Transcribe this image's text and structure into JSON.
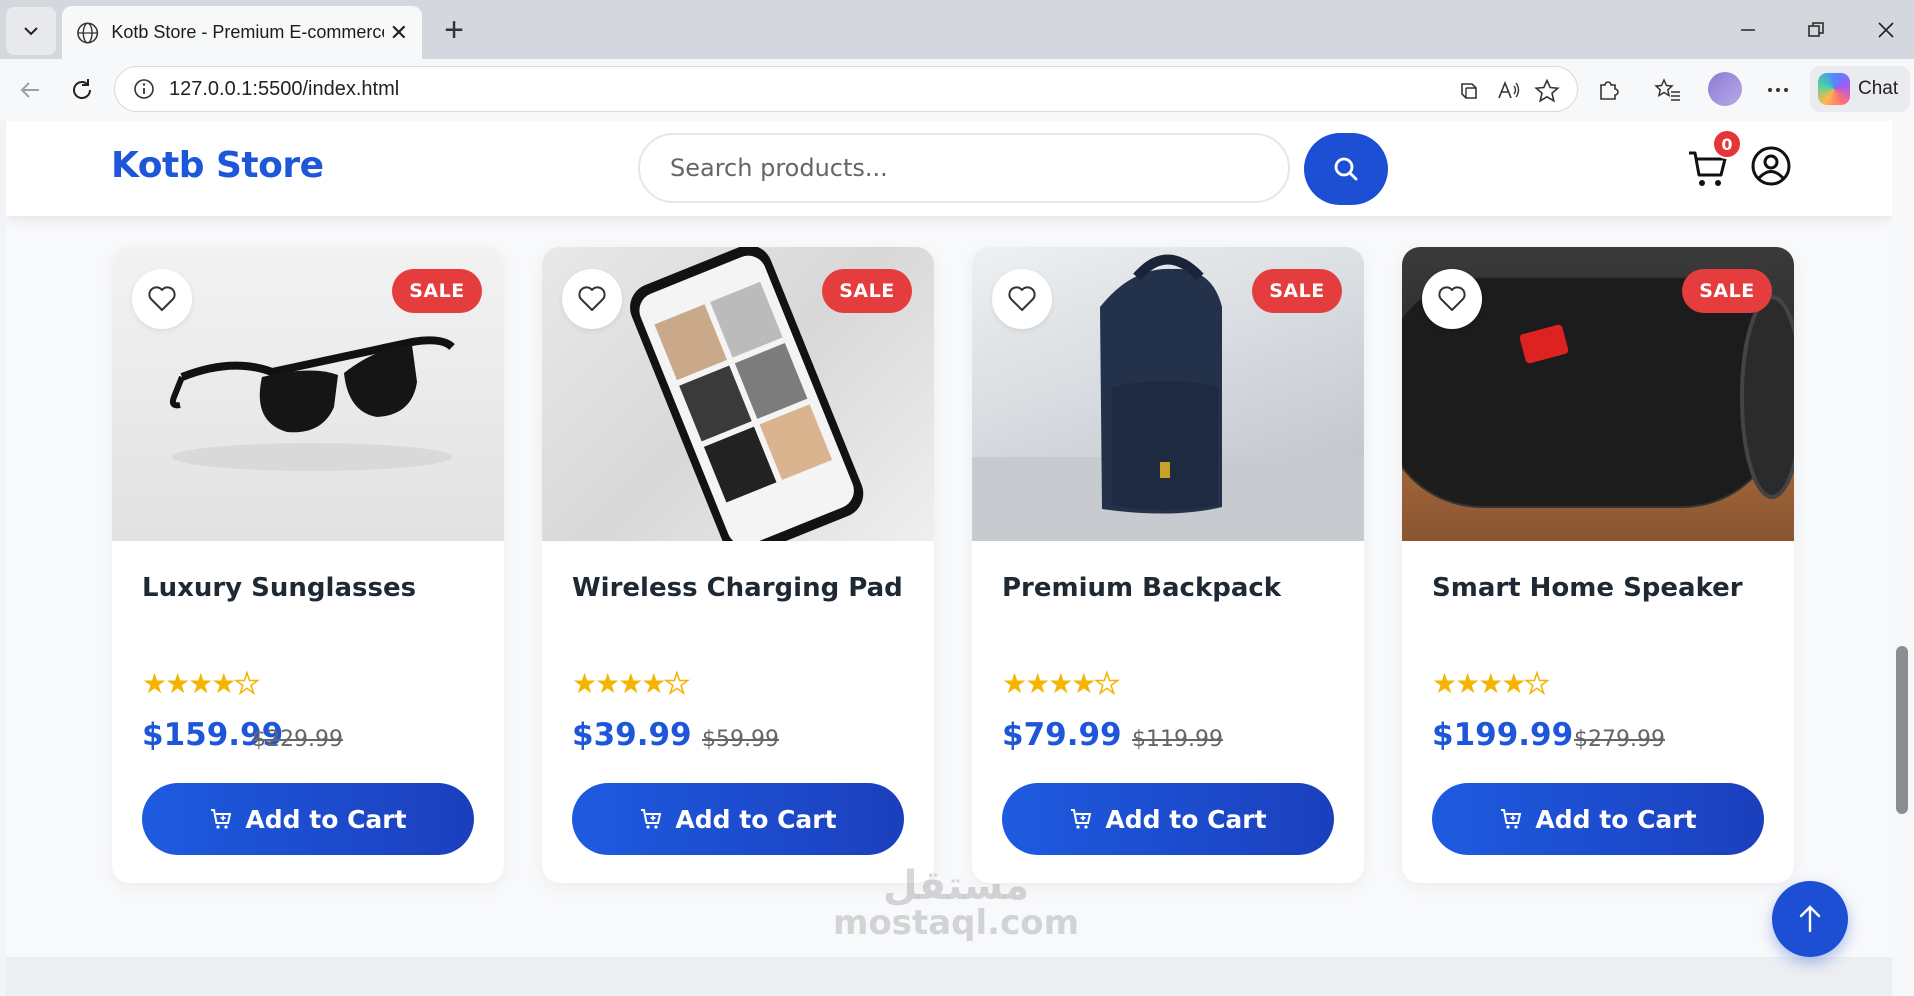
{
  "browser": {
    "tab_title": "Kotb Store - Premium E-commerce",
    "url": "127.0.0.1:5500/index.html",
    "chat_label": "Chat"
  },
  "site": {
    "logo": "Kotb Store",
    "search_placeholder": "Search products...",
    "cart_count": "0"
  },
  "products": [
    {
      "name": "Luxury Sunglasses",
      "price": "$159.99",
      "old_price": "$229.99",
      "badge": "SALE",
      "rating": 4.5,
      "stars": "★★★★",
      "cta": "Add to Cart"
    },
    {
      "name": "Wireless Charging Pad",
      "price": "$39.99",
      "old_price": "$59.99",
      "badge": "SALE",
      "rating": 4.5,
      "stars": "★★★★",
      "cta": "Add to Cart"
    },
    {
      "name": "Premium Backpack",
      "price": "$79.99",
      "old_price": "$119.99",
      "badge": "SALE",
      "rating": 4.5,
      "stars": "★★★★",
      "cta": "Add to Cart"
    },
    {
      "name": "Smart Home Speaker",
      "price": "$199.99",
      "old_price": "$279.99",
      "badge": "SALE",
      "rating": 4.5,
      "stars": "★★★★",
      "cta": "Add to Cart"
    }
  ],
  "watermark": {
    "arabic": "مستقل",
    "latin": "mostaql.com"
  },
  "colors": {
    "brand": "#1d56d8",
    "sale": "#e53d3d",
    "star": "#f5b400"
  }
}
